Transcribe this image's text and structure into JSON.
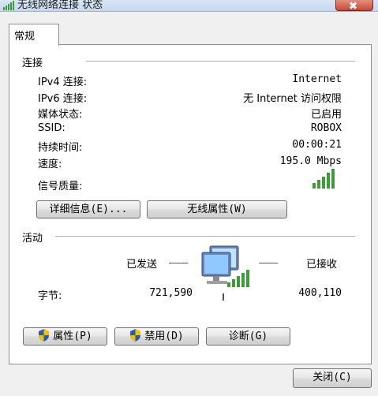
{
  "window": {
    "title": "无线网络连接 状态",
    "close_icon": "close-icon"
  },
  "tabs": [
    {
      "label": "常规"
    }
  ],
  "connection": {
    "heading": "连接",
    "rows": [
      {
        "label": "IPv4 连接:",
        "value": "Internet"
      },
      {
        "label": "IPv6 连接:",
        "value": "无 Internet 访问权限"
      },
      {
        "label": "媒体状态:",
        "value": "已启用"
      },
      {
        "label": "SSID:",
        "value": "ROBOX"
      },
      {
        "label": "持续时间:",
        "value": "00:00:21"
      },
      {
        "label": "速度:",
        "value": "195.0 Mbps"
      }
    ],
    "signal_label": "信号质量:",
    "signal_bars": 5,
    "signal_max": 5,
    "details_button": "详细信息(E)...",
    "wireless_props_button": "无线属性(W)"
  },
  "activity": {
    "heading": "活动",
    "sent_label": "已发送",
    "received_label": "已接收",
    "bytes_label": "字节:",
    "bytes_sent": "721,590",
    "bytes_received": "400,110"
  },
  "buttons": {
    "properties": "属性(P)",
    "disable": "禁用(D)",
    "diagnose": "诊断(G)",
    "close": "关闭(C)"
  },
  "colors": {
    "signal_green": "#3e9a3a",
    "shield_blue": "#2b5ca8",
    "shield_yellow": "#f2c200"
  }
}
